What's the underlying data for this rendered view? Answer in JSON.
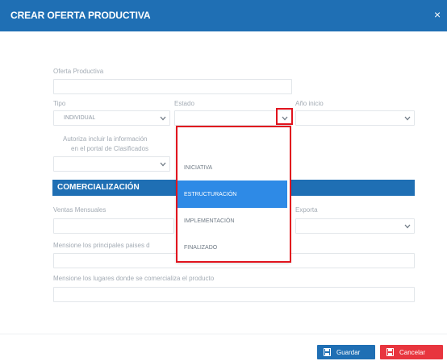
{
  "dialog": {
    "title": "CREAR OFERTA PRODUCTIVA",
    "close_symbol": "×"
  },
  "form": {
    "oferta_label": "Oferta Productiva",
    "oferta_value": "",
    "tipo_label": "Tipo",
    "tipo_value": "INDIVIDUAL",
    "estado_label": "Estado",
    "estado_value": "",
    "anio_label": "Año inicio",
    "anio_value": "",
    "autoriza_label_line1": "Autoriza incluir la información",
    "autoriza_label_line2": "en el portal de Clasificados",
    "autoriza_value": "",
    "section_title": "COMERCIALIZACIÓN",
    "ventas_label": "Ventas Mensuales",
    "exporta_label": "Exporta",
    "paises_label": "Mensione los principales paises d",
    "lugares_label": "Mensione los lugares donde se comercializa el producto"
  },
  "estado_dropdown": {
    "options": [
      "",
      "INICIATIVA",
      "ESTRUCTURACIÓN",
      "IMPLEMENTACIÓN",
      "FINALIZADO"
    ],
    "highlighted": "ESTRUCTURACIÓN"
  },
  "footer": {
    "save_label": "Guardar",
    "cancel_label": "Cancelar"
  },
  "colors": {
    "primary": "#1f6fb4",
    "danger": "#e8353e",
    "highlight": "#2e8ae6",
    "annotation_red": "#e1141e"
  },
  "icons": {
    "close": "close-icon",
    "chevron": "chevron-down-icon",
    "save": "floppy-disk-icon",
    "cancel": "floppy-disk-icon"
  }
}
